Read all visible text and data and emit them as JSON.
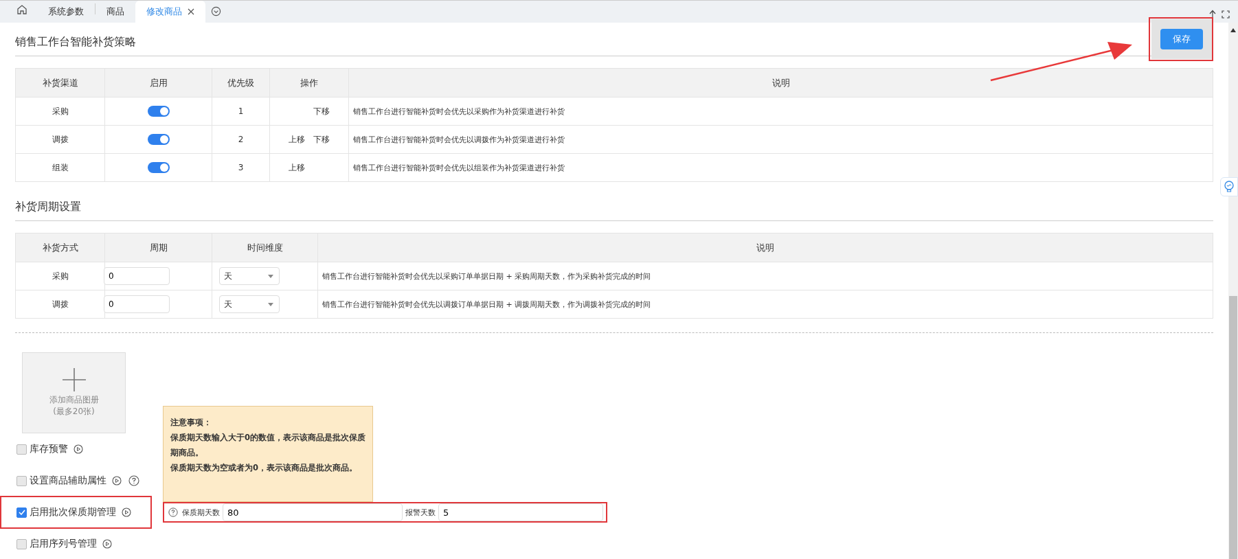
{
  "tabs": [
    {
      "label": "系统参数",
      "selected": false
    },
    {
      "label": "商品",
      "selected": false
    },
    {
      "label": "修改商品",
      "selected": true
    }
  ],
  "save_button": "保存",
  "strategy": {
    "title": "销售工作台智能补货策略",
    "columns": [
      "补货渠道",
      "启用",
      "优先级",
      "操作",
      "说明"
    ],
    "rows": [
      {
        "channel": "采购",
        "enabled": true,
        "priority": "1",
        "move_down": "下移",
        "description": "销售工作台进行智能补货时会优先以采购作为补货渠道进行补货"
      },
      {
        "channel": "调拨",
        "enabled": true,
        "priority": "2",
        "move_up": "上移",
        "move_down": "下移",
        "description": "销售工作台进行智能补货时会优先以调拨作为补货渠道进行补货"
      },
      {
        "channel": "组装",
        "enabled": true,
        "priority": "3",
        "move_up": "上移",
        "description": "销售工作台进行智能补货时会优先以组装作为补货渠道进行补货"
      }
    ]
  },
  "cycle": {
    "title": "补货周期设置",
    "columns": [
      "补货方式",
      "周期",
      "时间维度",
      "说明"
    ],
    "rows": [
      {
        "method": "采购",
        "period": "0",
        "unit": "天",
        "description": "销售工作台进行智能补货时会优先以采购订单单据日期 + 采购周期天数，作为采购补货完成的时间"
      },
      {
        "method": "调拨",
        "period": "0",
        "unit": "天",
        "description": "销售工作台进行智能补货时会优先以调拨订单单据日期 + 调拨周期天数，作为调拨补货完成的时间"
      }
    ]
  },
  "album": {
    "label": "添加商品图册",
    "note": "(最多20张)"
  },
  "options": [
    {
      "label": "库存预警",
      "checked": false,
      "help": false
    },
    {
      "label": "设置商品辅助属性",
      "checked": false,
      "help": true
    },
    {
      "label": "启用批次保质期管理",
      "checked": true,
      "help": false
    },
    {
      "label": "启用序列号管理",
      "checked": false,
      "help": false
    }
  ],
  "tooltip": {
    "title": "注意事项：",
    "lines": [
      "保质期天数输入大于0的数值，表示该商品是批次保质期商品。",
      "保质期天数为空或者为0，表示该商品是批次商品。"
    ]
  },
  "shelf_life": [
    {
      "label": "保质期天数",
      "value": "80"
    },
    {
      "label": "报警天数",
      "value": "5"
    }
  ]
}
